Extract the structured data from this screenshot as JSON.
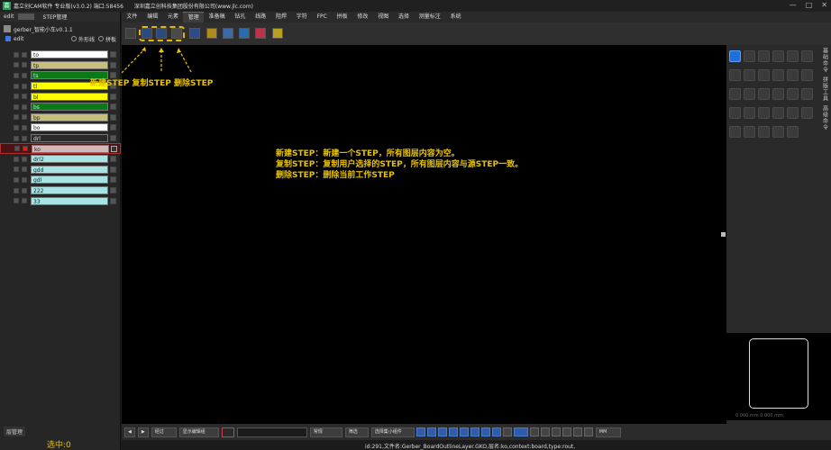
{
  "titlebar": {
    "app": "嘉立创CAM软件 专业版(v3.0.2) 端口:58456",
    "company": "深圳嘉立创科技集团股份有限公司(www.jlc.com)"
  },
  "left": {
    "tab_edit": "edit",
    "tab_step": "STEP管理",
    "job_name": "gerber_智能小车v0.1.1",
    "step_name": "edit",
    "opt_outline": "外形线",
    "opt_panel": "拼板",
    "layers": [
      {
        "name": "to",
        "color": "#ffffff"
      },
      {
        "name": "tp",
        "color": "#c8c07a"
      },
      {
        "name": "ts",
        "color": "#0a7a16"
      },
      {
        "name": "tl",
        "color": "#ffff00"
      },
      {
        "name": "bl",
        "color": "#ffff00"
      },
      {
        "name": "bs",
        "color": "#0a7a16"
      },
      {
        "name": "bp",
        "color": "#c8c07a"
      },
      {
        "name": "bo",
        "color": "#ffffff"
      },
      {
        "name": "drl",
        "color": "#2a2a2a"
      },
      {
        "name": "ko",
        "color": "#d4b8b8",
        "selected": true
      },
      {
        "name": "drl2",
        "color": "#a8e4e4"
      },
      {
        "name": "gdd",
        "color": "#a8e4e4"
      },
      {
        "name": "gdl",
        "color": "#a8e4e4"
      },
      {
        "name": "222",
        "color": "#a8e4e4"
      },
      {
        "name": "33",
        "color": "#a8e4e4"
      }
    ],
    "layer_manager": "层管理",
    "selected_count": "选中:0"
  },
  "menu": [
    "文件",
    "编辑",
    "元素",
    "管理",
    "准备稿",
    "钻孔",
    "线路",
    "阻焊",
    "字符",
    "FPC",
    "拼板",
    "修改",
    "视图",
    "选择",
    "测量标注",
    "系统"
  ],
  "active_menu_index": 3,
  "annotations": {
    "buttons": "新建STEP  复制STEP   删除STEP",
    "line1": "新建STEP：新建一个STEP，所有图层内容为空。",
    "line2": "复制STEP：复制用户选择的STEP，所有图层内容与源STEP一致。",
    "line3": "删除STEP：删除当前工作STEP"
  },
  "right": {
    "vtab1": "基础命令",
    "vtab2": "拼版工具",
    "vtab3": "高级命令",
    "scale": "0.000 mm   0.000 mm"
  },
  "bottombar": {
    "mode": "经过",
    "display": "显示编辑组",
    "filter_value": "",
    "view": "常规",
    "select": "筛选",
    "select_all": "选择集小组件",
    "unit": "MM"
  },
  "status": "id:291,文件名:Gerber_BoardOutlineLayer.GKO,层名:ko,context:board,type:rout,",
  "colors": {
    "annotation": "#e8c200",
    "highlight": "#e8b800",
    "accent": "#1e6fd9"
  }
}
